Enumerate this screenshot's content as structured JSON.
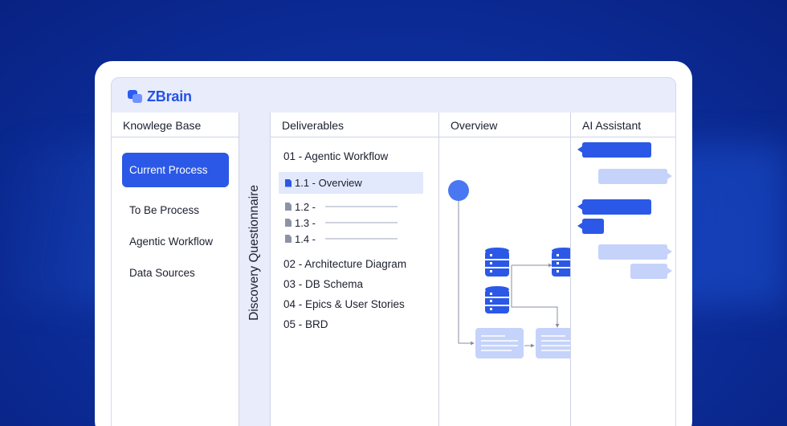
{
  "brand": {
    "name": "ZBrain"
  },
  "knowledge_base": {
    "title": "Knowlege Base",
    "items": [
      {
        "label": "Current Process",
        "active": true
      },
      {
        "label": "To Be Process",
        "active": false
      },
      {
        "label": "Agentic Workflow",
        "active": false
      },
      {
        "label": "Data Sources",
        "active": false
      }
    ]
  },
  "strip": {
    "label": "Discovery Questionnaire"
  },
  "deliverables": {
    "title": "Deliverables",
    "section_1": "01 - Agentic Workflow",
    "sub_active": "1.1 - Overview",
    "sub_2": "1.2 -",
    "sub_3": "1.3 -",
    "sub_4": "1.4 -",
    "section_2": "02 - Architecture Diagram",
    "section_3": "03 - DB Schema",
    "section_4": "04 - Epics & User Stories",
    "section_5": "05 - BRD"
  },
  "overview": {
    "title": "Overview"
  },
  "ai_assistant": {
    "title": "AI Assistant"
  },
  "colors": {
    "accent": "#2b58e6",
    "bubble_dark": "#2b58e6",
    "bubble_light": "#c5d3fb"
  },
  "icons": {
    "brand": "zbrain-logo-icon",
    "doc": "document-icon",
    "database": "database-icon"
  }
}
